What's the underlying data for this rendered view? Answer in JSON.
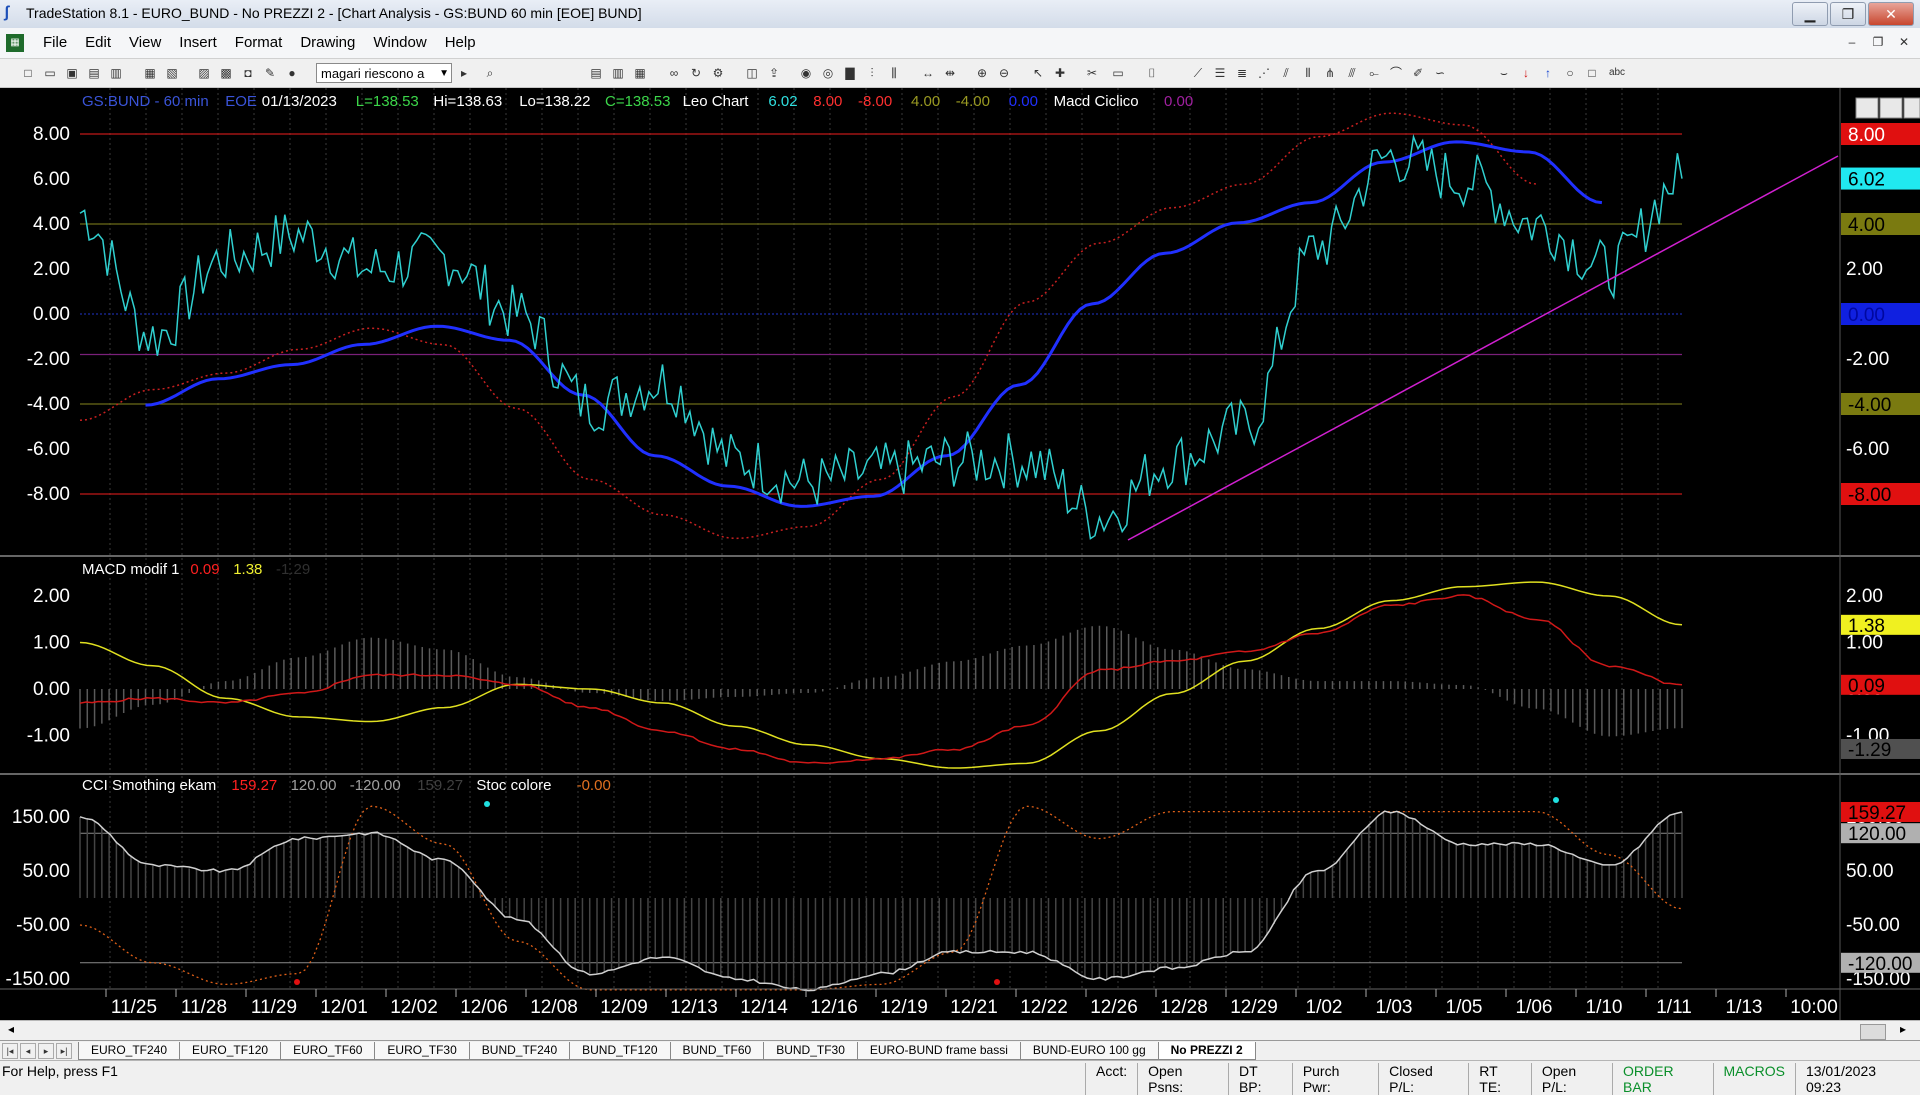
{
  "window": {
    "title": "TradeStation 8.1 - EURO_BUND - No PREZZI 2 - [Chart Analysis - GS:BUND  60 min  [EOE] BUND]",
    "minimize": "▁",
    "restore": "❐",
    "close": "✕"
  },
  "menu": {
    "items": [
      "File",
      "Edit",
      "View",
      "Insert",
      "Format",
      "Drawing",
      "Window",
      "Help"
    ]
  },
  "toolbar": {
    "combo_value": "magari riescono a"
  },
  "price_panel": {
    "header": [
      {
        "text": "GS:BUND - 60 min",
        "color": "#3a54d8"
      },
      {
        "text": "EOE",
        "color": "#3a54d8"
      },
      {
        "text": "01/13/2023",
        "color": "#ffffff"
      },
      {
        "text": "L=138.53",
        "color": "#3cd64a"
      },
      {
        "text": "Hi=138.63",
        "color": "#ffffff"
      },
      {
        "text": "Lo=138.22",
        "color": "#ffffff"
      },
      {
        "text": "C=138.53",
        "color": "#3cd64a"
      },
      {
        "text": "Leo Chart",
        "color": "#ffffff"
      },
      {
        "text": "6.02",
        "color": "#2fe0e0"
      },
      {
        "text": "8.00",
        "color": "#ff3030"
      },
      {
        "text": "-8.00",
        "color": "#ff3030"
      },
      {
        "text": "4.00",
        "color": "#9a9a22"
      },
      {
        "text": "-4.00",
        "color": "#9a9a22"
      },
      {
        "text": "0.00",
        "color": "#2030ff"
      },
      {
        "text": "Macd Ciclico",
        "color": "#ffffff"
      },
      {
        "text": "0.00",
        "color": "#a020a0"
      }
    ],
    "axis_labels": [
      "8.00",
      "6.00",
      "4.00",
      "2.00",
      "0.00",
      "-2.00",
      "-4.00",
      "-6.00",
      "-8.00"
    ],
    "markers": [
      {
        "text": "8.00",
        "bg": "#e01010",
        "fg": "#ffffff"
      },
      {
        "text": "6.02",
        "bg": "#20e8f0",
        "fg": "#000000"
      },
      {
        "text": "4.00",
        "bg": "#7a7a10",
        "fg": "#000000"
      },
      {
        "text": "0.00",
        "bg": "#1020e0",
        "fg": "#0008a0"
      },
      {
        "text": "-4.00",
        "bg": "#7a7a10",
        "fg": "#000000"
      },
      {
        "text": "-8.00",
        "bg": "#e01010",
        "fg": "#000000"
      }
    ]
  },
  "macd_panel": {
    "header": [
      {
        "text": "MACD modif 1",
        "color": "#ffffff"
      },
      {
        "text": "0.09",
        "color": "#ff2020"
      },
      {
        "text": "1.38",
        "color": "#f0f030"
      },
      {
        "text": "-1.29",
        "color": "#303030"
      }
    ],
    "axis_labels": [
      "2.00",
      "1.00",
      "0.00",
      "-1.00"
    ],
    "markers": [
      {
        "text": "1.38",
        "bg": "#f0f020",
        "fg": "#000000"
      },
      {
        "text": "0.09",
        "bg": "#e01010",
        "fg": "#000000"
      },
      {
        "text": "-1.29",
        "bg": "#505050",
        "fg": "#000000"
      }
    ]
  },
  "cci_panel": {
    "header": [
      {
        "text": "CCI Smothing ekam",
        "color": "#ffffff"
      },
      {
        "text": "159.27",
        "color": "#ff2020"
      },
      {
        "text": "120.00",
        "color": "#a0a0a0"
      },
      {
        "text": "-120.00",
        "color": "#a0a0a0"
      },
      {
        "text": "159.27",
        "color": "#404040"
      },
      {
        "text": "Stoc colore",
        "color": "#ffffff"
      },
      {
        "text": "-0.00",
        "color": "#e07020"
      }
    ],
    "axis_labels": [
      "150.00",
      "50.00",
      "-50.00",
      "-150.00"
    ],
    "markers": [
      {
        "text": "159.27",
        "bg": "#e01010",
        "fg": "#000000"
      },
      {
        "text": "120.00",
        "bg": "#b0b0b0",
        "fg": "#000000"
      },
      {
        "text": "-120.00",
        "bg": "#b0b0b0",
        "fg": "#000000"
      }
    ]
  },
  "time_axis": [
    "11/25",
    "11/28",
    "11/29",
    "12/01",
    "12/02",
    "12/06",
    "12/08",
    "12/09",
    "12/13",
    "12/14",
    "12/16",
    "12/19",
    "12/21",
    "12/22",
    "12/26",
    "12/28",
    "12/29",
    "1/02",
    "1/03",
    "1/05",
    "1/06",
    "1/10",
    "1/11",
    "1/13",
    "10:00"
  ],
  "workspace_tabs": [
    "EURO_TF240",
    "EURO_TF120",
    "EURO_TF60",
    "EURO_TF30",
    "BUND_TF240",
    "BUND_TF120",
    "BUND_TF60",
    "BUND_TF30",
    "EURO-BUND frame bassi",
    "BUND-EURO 100 gg",
    "No PREZZI 2"
  ],
  "status": {
    "help": "For Help, press F1",
    "fields": [
      "Acct:",
      "Open Psns:",
      "DT BP:",
      "Purch Pwr:",
      "Closed P/L:",
      "RT TE:",
      "Open P/L:",
      "ORDER BAR",
      "MACROS",
      "13/01/2023 09:23"
    ]
  },
  "chart_data": [
    {
      "type": "line",
      "title": "Leo Chart",
      "ylim": [
        -10,
        10
      ],
      "x": [
        "11/25",
        "11/28",
        "11/29",
        "12/01",
        "12/02",
        "12/06",
        "12/08",
        "12/09",
        "12/13",
        "12/14",
        "12/16",
        "12/19",
        "12/21",
        "12/22",
        "12/26",
        "12/28",
        "12/29",
        "1/02",
        "1/03",
        "1/05",
        "1/06",
        "1/10",
        "1/11"
      ],
      "series": [
        {
          "name": "Leo Chart",
          "values": [
            4.5,
            -1.0,
            2.5,
            3.5,
            2.0,
            2.5,
            0.0,
            -4.0,
            -3.0,
            -6.5,
            -7.5,
            -7.0,
            -6.5,
            -6.5,
            -9.0,
            -6.5,
            -5.0,
            3.0,
            7.0,
            6.0,
            4.0,
            2.0,
            6.02
          ]
        },
        {
          "name": "Macd Ciclico",
          "values": [
            -4.5,
            -3.2,
            -2.5,
            -1.5,
            -0.6,
            -1.3,
            -4.0,
            -7.0,
            -8.5,
            -9.5,
            -9.0,
            -7.0,
            -3.5,
            0.5,
            3.0,
            4.5,
            5.5,
            7.5,
            8.5,
            8.0,
            5.5,
            null,
            null
          ]
        }
      ]
    },
    {
      "type": "line",
      "title": "MACD modif 1",
      "ylim": [
        -1.7,
        2.5
      ],
      "x": [
        "11/25",
        "11/28",
        "11/29",
        "12/01",
        "12/02",
        "12/06",
        "12/08",
        "12/09",
        "12/13",
        "12/14",
        "12/16",
        "12/19",
        "12/21",
        "12/22",
        "12/26",
        "12/28",
        "12/29",
        "1/02",
        "1/03",
        "1/05",
        "1/06",
        "1/10",
        "1/11"
      ],
      "series": [
        {
          "values": [
            1.0,
            0.5,
            -0.2,
            -0.6,
            -0.7,
            -0.4,
            0.1,
            0.0,
            -0.3,
            -0.8,
            -1.2,
            -1.5,
            -1.7,
            -1.6,
            -0.9,
            -0.1,
            0.6,
            1.3,
            1.9,
            2.2,
            2.3,
            2.0,
            1.38
          ]
        },
        {
          "values": [
            -0.3,
            -0.2,
            -0.3,
            -0.1,
            0.3,
            0.3,
            0.1,
            -0.4,
            -0.9,
            -1.3,
            -1.6,
            -1.5,
            -1.3,
            -0.8,
            0.4,
            0.6,
            0.8,
            1.2,
            1.8,
            2.0,
            1.5,
            0.5,
            0.09
          ]
        }
      ]
    },
    {
      "type": "line",
      "title": "CCI Smothing ekam",
      "ylim": [
        -170,
        180
      ],
      "x": [
        "11/25",
        "11/28",
        "11/29",
        "12/01",
        "12/02",
        "12/06",
        "12/08",
        "12/09",
        "12/13",
        "12/14",
        "12/16",
        "12/19",
        "12/21",
        "12/22",
        "12/26",
        "12/28",
        "12/29",
        "1/02",
        "1/03",
        "1/05",
        "1/06",
        "1/10",
        "1/11"
      ],
      "series": [
        {
          "values": [
            150,
            60,
            50,
            110,
            120,
            70,
            -40,
            -140,
            -110,
            -150,
            -170,
            -140,
            -100,
            -100,
            -150,
            -130,
            -100,
            50,
            160,
            100,
            100,
            60,
            159.27
          ]
        },
        {
          "values": [
            -50,
            -120,
            -160,
            -140,
            170,
            100,
            -80,
            -170,
            -170,
            -170,
            -170,
            -160,
            -100,
            170,
            110,
            160,
            160,
            160,
            160,
            160,
            160,
            80,
            -20
          ]
        }
      ]
    }
  ]
}
